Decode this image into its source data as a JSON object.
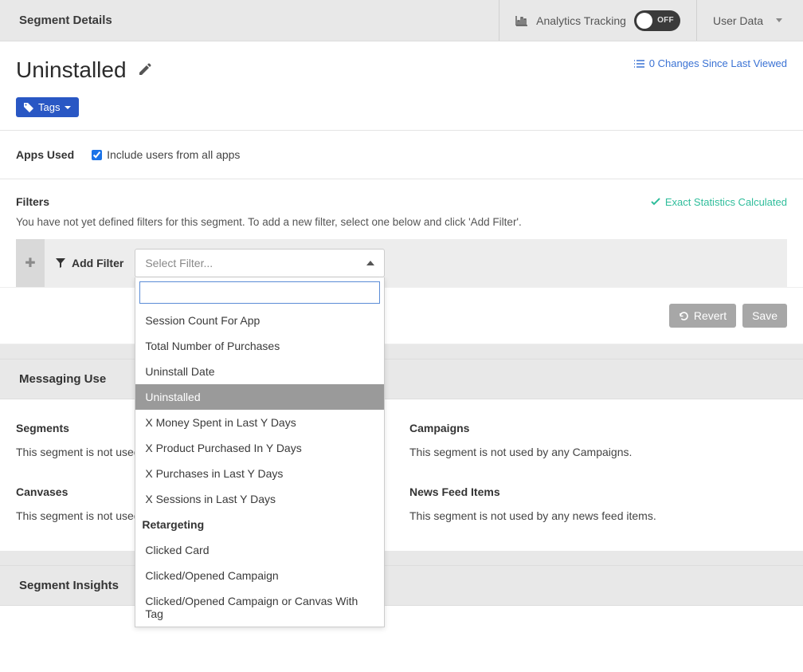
{
  "topbar": {
    "title": "Segment Details",
    "analytics_label": "Analytics Tracking",
    "toggle_state": "OFF",
    "user_data_label": "User Data"
  },
  "header": {
    "title": "Uninstalled",
    "changes_text": "0 Changes Since Last Viewed"
  },
  "tags": {
    "button_label": "Tags"
  },
  "apps_used": {
    "label": "Apps Used",
    "checkbox_label": "Include users from all apps",
    "checked": true
  },
  "filters": {
    "title": "Filters",
    "stats_label": "Exact Statistics Calculated",
    "description": "You have not yet defined filters for this segment. To add a new filter, select one below and click 'Add Filter'.",
    "add_filter_label": "Add Filter",
    "select_placeholder": "Select Filter...",
    "search_value": "",
    "options": [
      {
        "type": "item",
        "label": "Session Count For App"
      },
      {
        "type": "item",
        "label": "Total Number of Purchases"
      },
      {
        "type": "item",
        "label": "Uninstall Date"
      },
      {
        "type": "item",
        "label": "Uninstalled",
        "selected": true
      },
      {
        "type": "item",
        "label": "X Money Spent in Last Y Days"
      },
      {
        "type": "item",
        "label": "X Product Purchased In Y Days"
      },
      {
        "type": "item",
        "label": "X Purchases in Last Y Days"
      },
      {
        "type": "item",
        "label": "X Sessions in Last Y Days"
      },
      {
        "type": "group",
        "label": "Retargeting"
      },
      {
        "type": "item",
        "label": "Clicked Card"
      },
      {
        "type": "item",
        "label": "Clicked/Opened Campaign"
      },
      {
        "type": "item",
        "label": "Clicked/Opened Campaign or Canvas With Tag"
      }
    ]
  },
  "actions": {
    "revert_label": "Revert",
    "save_label": "Save"
  },
  "messaging_use": {
    "heading": "Messaging Use",
    "segments": {
      "title": "Segments",
      "text": "This segment is not used"
    },
    "campaigns": {
      "title": "Campaigns",
      "text": "This segment is not used by any Campaigns."
    },
    "canvases": {
      "title": "Canvases",
      "text": "This segment is not used"
    },
    "newsfeed": {
      "title": "News Feed Items",
      "text": "This segment is not used by any news feed items."
    }
  },
  "segment_insights": {
    "heading": "Segment Insights"
  }
}
